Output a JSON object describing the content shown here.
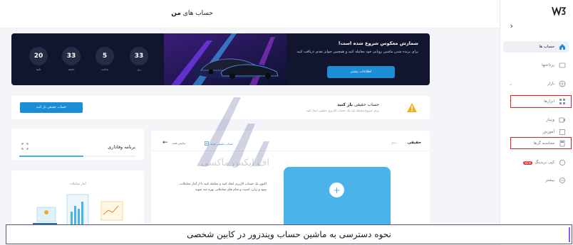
{
  "app": {
    "brand": "W3"
  },
  "colors": {
    "accent": "#1b8ed6",
    "banner_bg": "#11162e",
    "highlight": "#e4222a",
    "card": "#4ab3ea"
  },
  "header": {
    "title_prefix": "حساب های",
    "title_bold": "من"
  },
  "sidebar": {
    "items": [
      {
        "label": "حساب ها",
        "icon": "home-icon",
        "active": true
      },
      {
        "label": "پرداختها",
        "icon": "wallet-icon"
      },
      {
        "label": "بازار",
        "icon": "globe-icon"
      },
      {
        "label": "ابزارها",
        "icon": "grid-icon"
      },
      {
        "label": "وبینار",
        "icon": "video-icon"
      },
      {
        "label": "آموزش",
        "icon": "book-icon"
      },
      {
        "label": "محاسبه گرها",
        "icon": "calculator-icon"
      },
      {
        "label": "کپی تریدینگ",
        "icon": "copy-icon",
        "badge": "NEW"
      },
      {
        "label": "بیشتر",
        "icon": "dots-icon"
      }
    ]
  },
  "banner": {
    "title": "شمارش معکوس شروع شده است!",
    "subtitle": "برای برنده شدن ماشین رویایی خود معامله کنید و همچنین جوایز نقدی دریافت کنید",
    "cta": "اطلاعات بیشتر",
    "countdown": [
      {
        "value": "33",
        "unit": "روز"
      },
      {
        "value": "5",
        "unit": "ساعت"
      },
      {
        "value": "33",
        "unit": "دقیقه"
      },
      {
        "value": "20",
        "unit": "ثانیه"
      }
    ]
  },
  "real_account": {
    "title_prefix": "حساب حقیقی",
    "title_bold": "باز کنید",
    "subtitle": "برای شروع معامله باید یک حساب کاربری حقیقی ایجاد کنید",
    "button": "حساب حقیقی باز کنید"
  },
  "loyalty": {
    "title": "برنامه وفاداری",
    "progress": 0.55
  },
  "stats": {
    "title": "آمار معاملات"
  },
  "accounts": {
    "tab_real": "حقیقی",
    "tab_demo": "دمو",
    "link_new": "حساب حقیقی جدید",
    "link_all": "نمایش همه",
    "empty_text": "اکنون یک حساب کاربری ایجاد کنید و معامله کنید تا از آمار معاملات، سود و زیان، امنیت و تمام های معاملاتی بهره مند شوید"
  },
  "watermark": {
    "text": "اف ایکس ماکسی"
  },
  "caption": {
    "text": "نحوه دسترسی به ماشین حساب ویندزور در کابین شخصی"
  }
}
